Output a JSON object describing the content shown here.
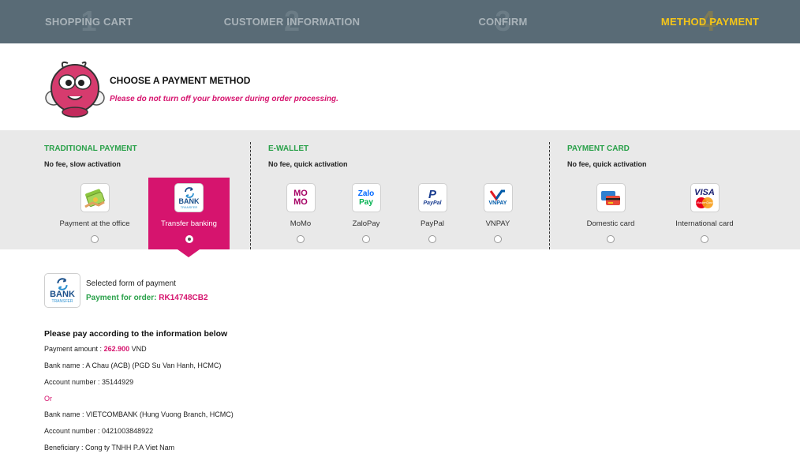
{
  "steps": [
    {
      "num": "1",
      "label": "SHOPPING CART"
    },
    {
      "num": "2",
      "label": "CUSTOMER INFORMATION"
    },
    {
      "num": "3",
      "label": "CONFIRM"
    },
    {
      "num": "4",
      "label": "METHOD PAYMENT"
    }
  ],
  "header": {
    "title": "CHOOSE A PAYMENT METHOD",
    "subtitle": "Please do not turn off your browser during order processing."
  },
  "groups": {
    "traditional": {
      "title": "TRADITIONAL PAYMENT",
      "sub": "No fee, slow activation"
    },
    "ewallet": {
      "title": "E-WALLET",
      "sub": "No fee, quick activation"
    },
    "card": {
      "title": "PAYMENT CARD",
      "sub": "No fee, quick activation"
    }
  },
  "options": {
    "office": {
      "label": "Payment at the office",
      "icon": "cash-icon"
    },
    "transfer": {
      "label": "Transfer banking",
      "icon": "bank-transfer-icon",
      "logo_main": "BANK",
      "logo_sub": "TRANSFER"
    },
    "momo": {
      "label": "MoMo",
      "icon": "momo-icon",
      "logo_line1": "MO",
      "logo_line2": "MO"
    },
    "zalopay": {
      "label": "ZaloPay",
      "icon": "zalopay-icon",
      "logo_line1": "Zalo",
      "logo_line2": "Pay"
    },
    "paypal": {
      "label": "PayPal",
      "icon": "paypal-icon",
      "logo_mark": "P",
      "logo_text": "PayPal"
    },
    "vnpay": {
      "label": "VNPAY",
      "icon": "vnpay-icon",
      "logo_text": "VNPAY"
    },
    "domestic": {
      "label": "Domestic card",
      "icon": "domestic-card-icon"
    },
    "international": {
      "label": "International card",
      "icon": "visa-mastercard-icon",
      "logo_visa": "VISA",
      "logo_mc": "MasterCard"
    }
  },
  "selected": {
    "label": "Selected form of payment",
    "order_prefix": "Payment for order:",
    "order_code": "RK14748CB2"
  },
  "info": {
    "title": "Please pay according to the information below",
    "amount_prefix": "Payment amount :",
    "amount": "262.900",
    "currency": "VND",
    "bank1": "Bank name : A Chau (ACB) (PGD Su Van Hanh, HCMC)",
    "account1": "Account number : 35144929",
    "or": "Or",
    "bank2": "Bank name : VIETCOMBANK (Hung Vuong Branch, HCMC)",
    "account2": "Account number : 0421003848922",
    "beneficiary": "Beneficiary : Cong ty TNHH P.A Viet Nam"
  },
  "colors": {
    "accent": "#d6146e",
    "green": "#2aa14a",
    "steps_bg": "#596b76",
    "active_step": "#f5c518"
  }
}
